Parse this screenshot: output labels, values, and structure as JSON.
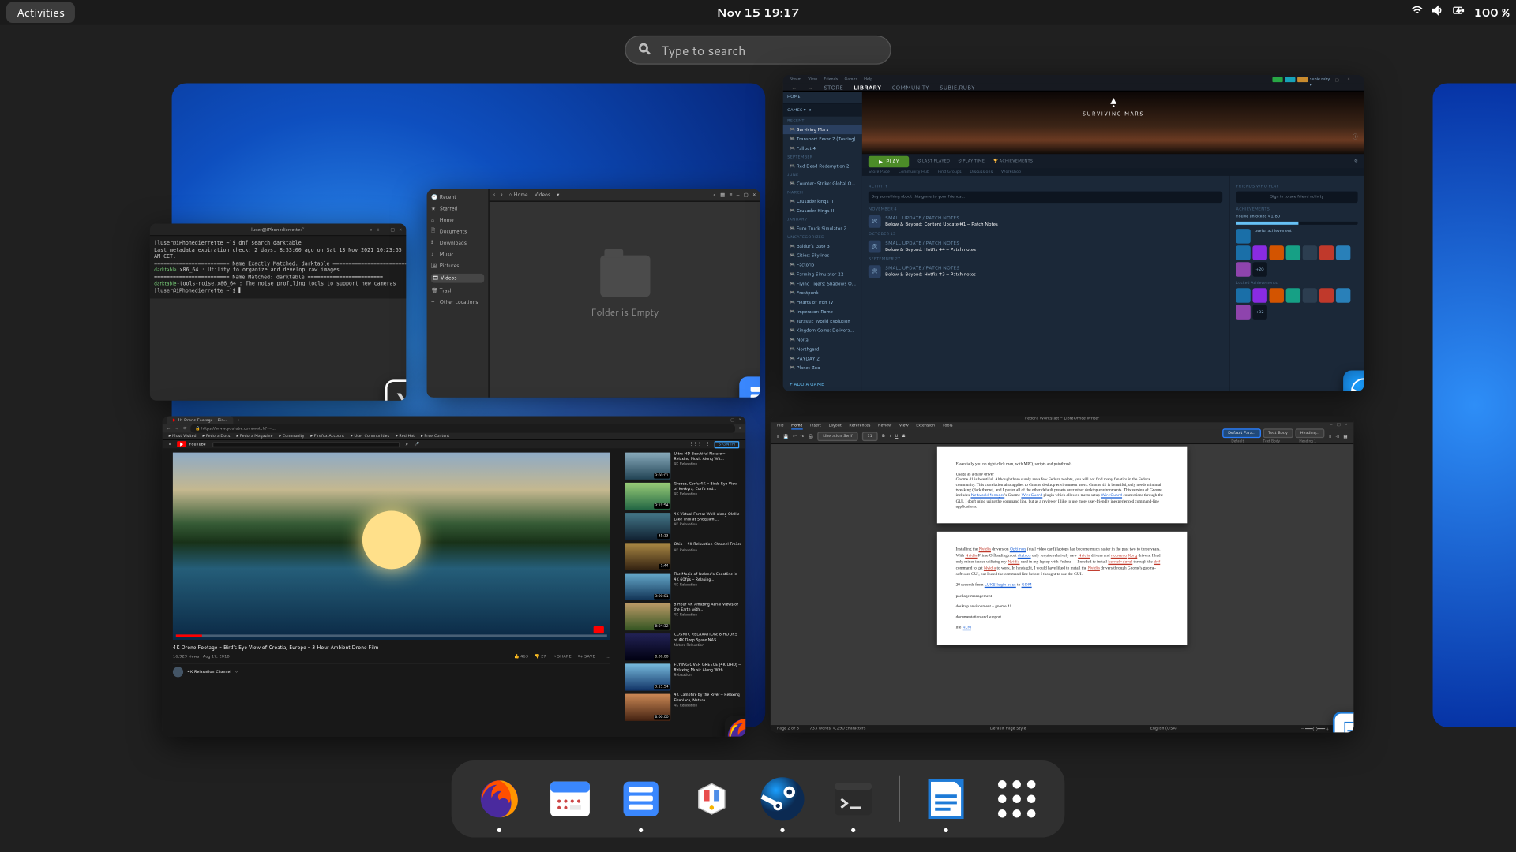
{
  "topbar": {
    "activities": "Activities",
    "clock": "Nov 15  19:17",
    "battery": "100 %"
  },
  "search": {
    "placeholder": "Type to search"
  },
  "terminal": {
    "titlebar_user": "luser@iPhonedierrette:~",
    "lines_html": "[luser@iPhonedierrette ~]$ dnf search darktable\\nLast metadata expiration check: 2 days, 8:53:00 ago on Sat 13 Nov 2021 10:23:55\\nAM CET.\\n======================== Name Exactly Matched: darktable ========================\\n<span class=g>darktable</span>.x86_64 : Utility to organize and develop raw images\\n======================== Name Matched: darktable ========================\\n<span class=g>darktable</span>-tools-noise.x86_64 : The noise profiling tools to support new cameras\\n[luser@iPhonedierrette ~]$ ▌"
  },
  "files": {
    "breadcrumb_home": "Home",
    "breadcrumb_current": "Videos",
    "sidebar": [
      "Recent",
      "Starred",
      "Home",
      "Documents",
      "Downloads",
      "Music",
      "Pictures",
      "Videos",
      "Trash",
      "Other Locations"
    ],
    "sidebar_selected": "Videos",
    "empty_label": "Folder is Empty"
  },
  "steam": {
    "nav": [
      "STORE",
      "LIBRARY",
      "COMMUNITY",
      "SUBIE.RUBY"
    ],
    "nav_selected": "LIBRARY",
    "sidebar": {
      "sections": [
        {
          "hdr": "RECENT",
          "rows": [
            {
              "t": "Surviving Mars",
              "sel": true
            },
            {
              "t": "Transport Fever 2 (Testing)"
            },
            {
              "t": "Fallout 4"
            }
          ]
        },
        {
          "hdr": "SEPTEMBER",
          "rows": [
            {
              "t": "Red Dead Redemption 2"
            }
          ]
        },
        {
          "hdr": "JUNE",
          "rows": [
            {
              "t": "Counter-Strike: Global Offensive"
            }
          ]
        },
        {
          "hdr": "MARCH",
          "rows": [
            {
              "t": "Crusader kings II"
            },
            {
              "t": "Crusader Kings III"
            }
          ]
        },
        {
          "hdr": "JANUARY",
          "rows": [
            {
              "t": "Euro Truck Simulator 2"
            }
          ]
        },
        {
          "hdr": "UNCATEGORIZED",
          "rows": [
            {
              "t": "Baldur's Gate 3"
            },
            {
              "t": "Cities: Skylines"
            },
            {
              "t": "Factorio"
            },
            {
              "t": "Farming Simulator 22"
            },
            {
              "t": "Flying Tigers: Shadows Over Ch…"
            },
            {
              "t": "Frostpunk"
            },
            {
              "t": "Hearts of Iron IV"
            },
            {
              "t": "Imperator: Rome"
            },
            {
              "t": "Jurassic World Evolution"
            },
            {
              "t": "Kingdom Come: Deliverance"
            },
            {
              "t": "Noita"
            },
            {
              "t": "Northgard"
            },
            {
              "t": "PAYDAY 2"
            },
            {
              "t": "Planet Zoo"
            }
          ]
        }
      ],
      "add_game": "ADD A GAME"
    },
    "hero_title": "SURVIVING MARS",
    "play": "PLAY",
    "stats": [
      "LAST PLAYED",
      "PLAY TIME",
      "ACHIEVEMENTS"
    ],
    "feed": {
      "activity_hdr": "ACTIVITY",
      "activity_prompt": "Say something about this game to your friends…",
      "groups": [
        {
          "date": "NOVEMBER 4",
          "rows": [
            {
              "kind": "SMALL UPDATE / PATCH NOTES",
              "title": "Below & Beyond: Content Update #1 – Patch Notes"
            }
          ]
        },
        {
          "date": "OCTOBER 13",
          "rows": [
            {
              "kind": "SMALL UPDATE / PATCH NOTES",
              "title": "Below & Beyond: Hotfix #4 – Patch notes"
            }
          ]
        },
        {
          "date": "SEPTEMBER 27",
          "rows": [
            {
              "kind": "SMALL UPDATE / PATCH NOTES",
              "title": "Below & Beyond: Hotfix #3 – Patch notes"
            }
          ]
        }
      ],
      "friends_hdr": "FRIENDS WHO PLAY",
      "friends_sign_in": "Sign in to see friend activity",
      "ach_hdr": "ACHIEVEMENTS",
      "ach_progress": "You've unlocked 41/80",
      "ach_row1": [
        "useful achievement"
      ],
      "ach_plus1": "+20",
      "ach_plus2": "+32",
      "locked": "Locked Achievements"
    }
  },
  "browser": {
    "tab_title": "4K Drone Footage – Bir…",
    "url": "https://www.youtube.com/watch?v=…",
    "bookmarks": [
      "Most Visited",
      "Fedora Docs",
      "Fedora Magazine",
      "Community",
      "Firefox Account",
      "User Communities",
      "Red Hat",
      "Free Content"
    ],
    "yt": {
      "brand": "YouTube",
      "title": "4K Drone Footage - Bird's Eye View of Croatia, Europe - 3 Hour Ambient Drone Film",
      "views": "16,929 views · Aug 17, 2018",
      "actions": [
        "463",
        "27",
        "SHARE",
        "SAVE",
        "…"
      ],
      "channel": "4K Relaxation Channel",
      "sidebar": [
        {
          "t": "Ultra HD Beautiful Nature – Relaxing Music Along Wit…",
          "ch": "4K Relaxation",
          "len": "3:00:01"
        },
        {
          "t": "Greece, Corfu 4K – Birds Eye View of Kerkyra, Corfu and…",
          "ch": "4K Relaxation",
          "len": "3:19:54"
        },
        {
          "t": "4K Virtual Forest Walk along Olallie Lake Trail at Snoquami…",
          "ch": "4K Relaxation",
          "len": "35:13"
        },
        {
          "t": "Ohio – 4K Relaxation Channel Trailer",
          "ch": "4K Relaxation",
          "len": "1:44"
        },
        {
          "t": "The Magic of Iceland's Coastline in 4K 60fps – Relaxing…",
          "ch": "4K Relaxation",
          "len": "3:00:01"
        },
        {
          "t": "8 Hour 4K Amazing Aerial Views of the Earth with…",
          "ch": "4K Relaxation",
          "len": "8:04:32"
        },
        {
          "t": "COSMIC RELAXATION: 8 HOURS of 4K Deep Space NAS…",
          "ch": "Nature Relaxation",
          "len": "8:00:00"
        },
        {
          "t": "FLYING OVER GREECE (4K UHD) – Relaxing Music Along With…",
          "ch": "Relaxation",
          "len": "3:19:54"
        },
        {
          "t": "4K Campfire by the River – Relaxing Fireplace, Nature…",
          "ch": "4K Relaxation",
          "len": "8:00:00"
        }
      ]
    }
  },
  "writer": {
    "title": "Fedora Workstatt - LibreOffice Writer",
    "menu": [
      "File",
      "Home",
      "Insert",
      "Layout",
      "References",
      "Review",
      "View",
      "Extension",
      "Tools"
    ],
    "font": "Liberation Serif",
    "size": "11",
    "styles": [
      "Default Para…",
      "Text Body",
      "Heading…"
    ],
    "style_labels": [
      "Default",
      "Text Body",
      "Heading 1"
    ],
    "page1": "Essentially you no right-click man, with MPQ, scripts and paintbrush.\\n\\nUsage as a daily driver\\n     Gnome 41 is beautiful. Although there surely are a few Fedora zealots, you will not find many fanatics in the Fedora community. This correlation also applies to Gnome desktop environment users. Gnome 41 is beautiful, only needs minimal tweaking (dark theme), and I prefer all of the other default presets over other desktop environments. This version of Gnome includes NetworkManager's Gnome WireGuard plugin which allowed me to setup WireGuard connections through the GUI. I don't mind using the command line, but as a reviewer I like to use more user-friendly inexperienced command-line applications.",
    "page2": "     Installing the Nvidia drivers on Optimus (dual video card) laptops has become much easier in the past two to three years. With Nvidia Prime Offloading most distros only require relatively new Nvidia drivers and nouveau Xorg drivers. I had only minor issues utilizing my Nvidia card in my laptop with Fedora — I needed to install kernel-devel through the dnf command to get Nvidia to work. In hindsight, I would have liked to install the Nvidia drivers through Gnome's gnome-software GUI, but I used the command line before I thought to use the GUI.\\n\\n20 seconds from LUKS login pass to GDM\\n\\npackage management\\n\\ndesktop environment – gnome 41\\n\\ndocumentation and support\\n\\nlite ALM",
    "status": {
      "page": "Page 2 of 3",
      "words": "733 words; 4,290 characters",
      "style": "Default Page Style",
      "lang": "English (USA)",
      "zoom": "50%"
    }
  },
  "dash": [
    {
      "name": "firefox",
      "running": true
    },
    {
      "name": "calendar",
      "running": false
    },
    {
      "name": "files",
      "running": true
    },
    {
      "name": "software",
      "running": false
    },
    {
      "name": "steam",
      "running": true
    },
    {
      "name": "terminal",
      "running": true
    },
    {
      "name": "writer",
      "running": true
    }
  ]
}
